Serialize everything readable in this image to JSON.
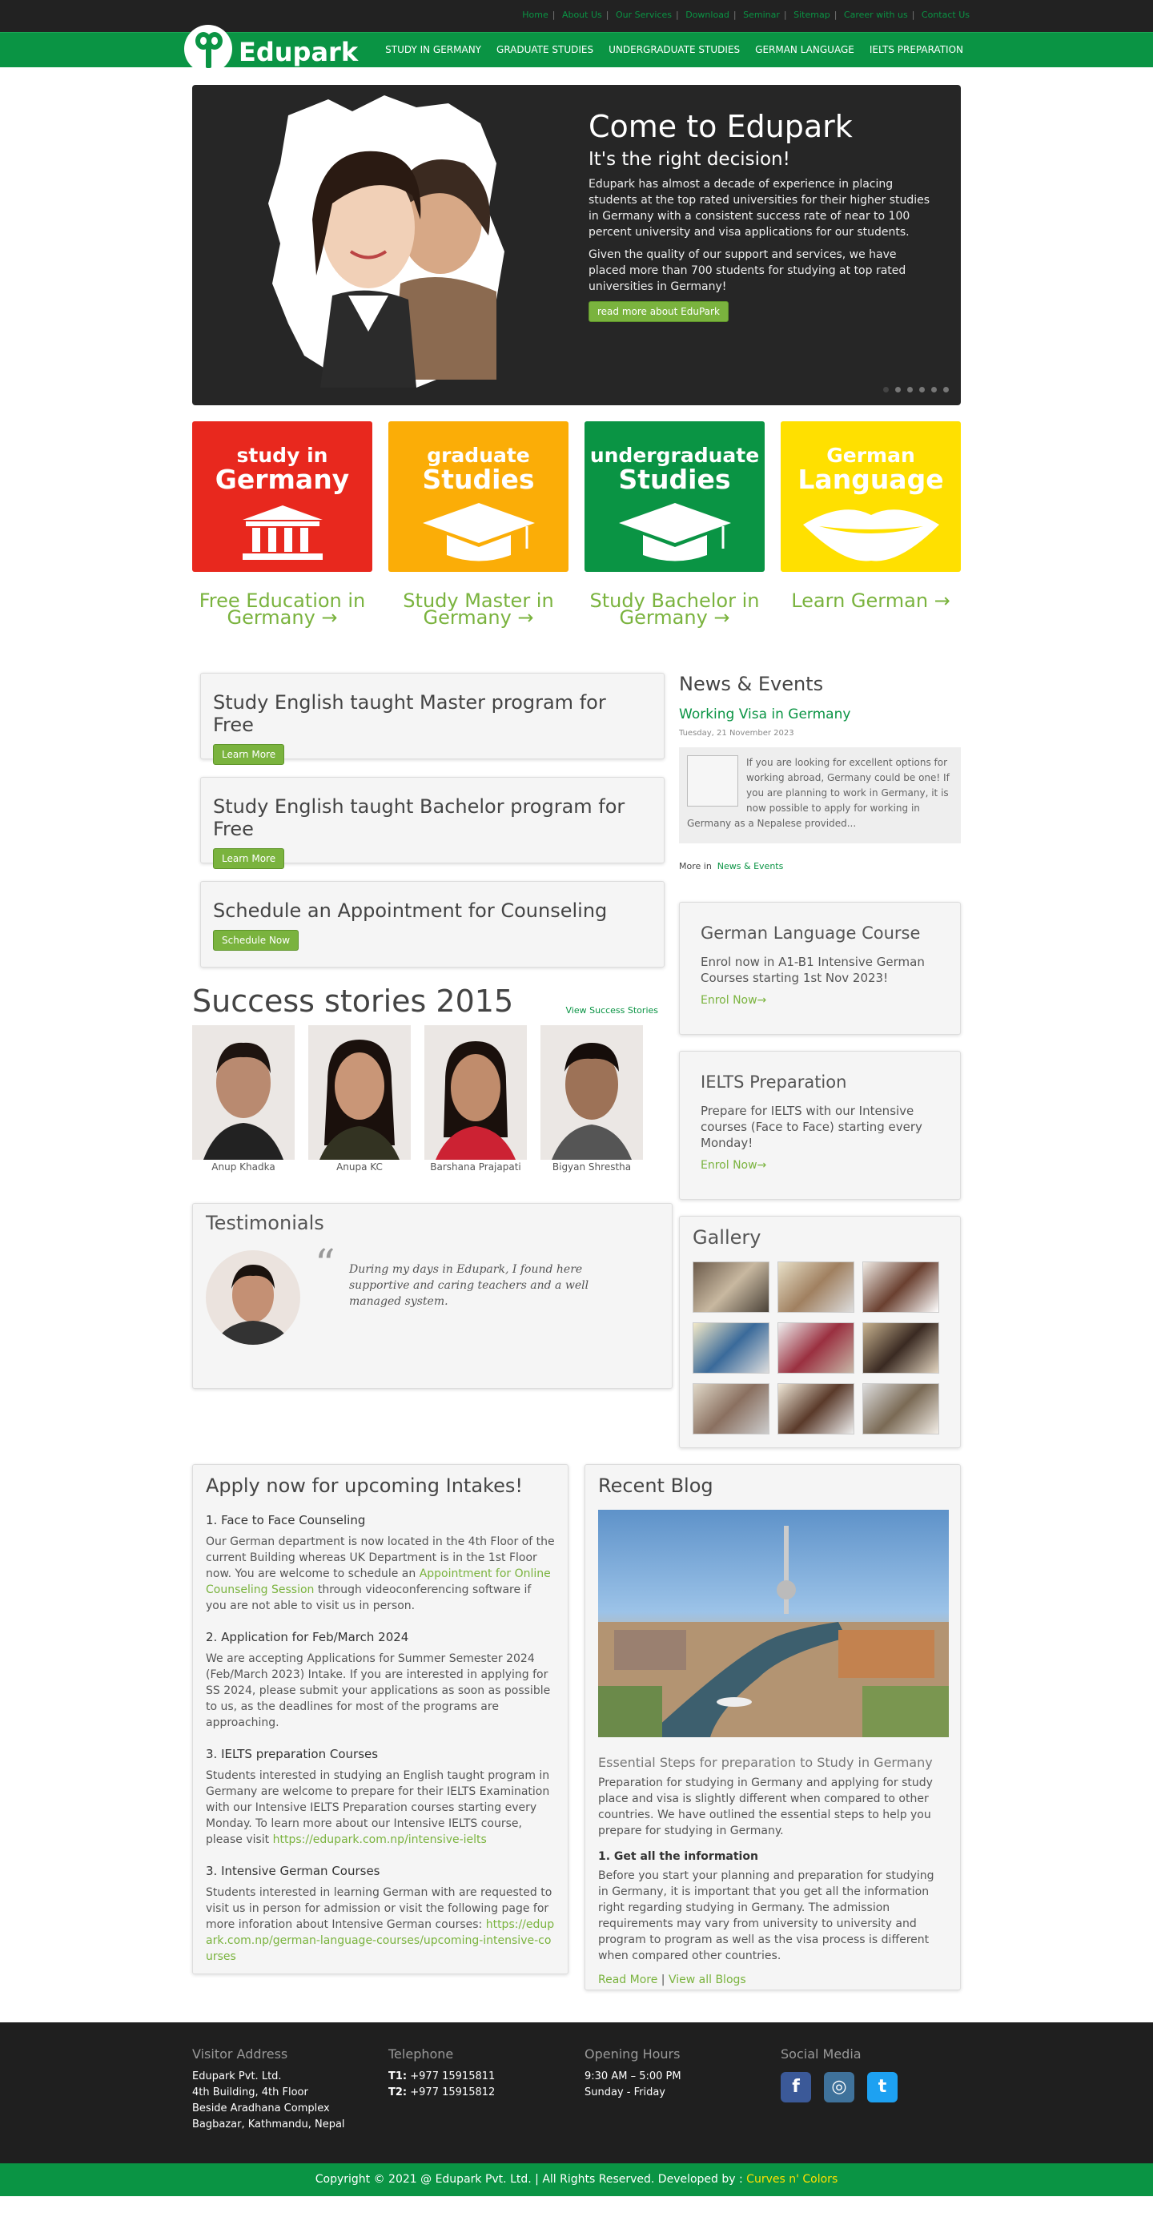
{
  "top_links": [
    "Home",
    "About Us",
    "Our Services",
    "Download",
    "Seminar",
    "Sitemap",
    "Career with us",
    "Contact Us"
  ],
  "brand": {
    "name": "Edupark",
    "color": "#0a9444"
  },
  "nav": [
    "STUDY IN GERMANY",
    "GRADUATE STUDIES",
    "UNDERGRADUATE STUDIES",
    "GERMAN LANGUAGE",
    "IELTS PREPARATION"
  ],
  "hero": {
    "title": "Come to Edupark",
    "subtitle": "It's the right decision!",
    "para1": "Edupark has almost a decade of experience in placing students at the top rated universities for their higher studies in Germany with a consistent success rate of near to 100 percent university and visa applications for our students.",
    "para2": "Given the quality of our support and services, we have placed more than 700 students for studying at top rated universities in Germany!",
    "button": "read more about EduPark"
  },
  "tiles": [
    {
      "line1": "study in",
      "line2": "Germany",
      "link": "Free Education in Germany →",
      "color": "#e8281e",
      "icon": "building-icon"
    },
    {
      "line1": "graduate",
      "line2": "Studies",
      "link": "Study Master in Germany →",
      "color": "#fbad07",
      "icon": "graduation-cap-icon"
    },
    {
      "line1": "undergraduate",
      "line2": "Studies",
      "link": "Study Bachelor in Germany →",
      "color": "#0a9444",
      "icon": "graduation-cap-icon"
    },
    {
      "line1": "German",
      "line2": "Language",
      "link": "Learn German →",
      "color": "#ffe000",
      "icon": "lips-icon"
    }
  ],
  "cta": [
    {
      "title": "Study English taught Master program for Free",
      "button": "Learn More"
    },
    {
      "title": "Study English taught Bachelor program for Free",
      "button": "Learn More"
    },
    {
      "title": "Schedule an Appointment for Counseling",
      "button": "Schedule Now"
    }
  ],
  "news": {
    "heading": "News & Events",
    "item_title": "Working Visa in Germany",
    "date": "Tuesday, 21 November 2023",
    "excerpt": "If you are looking for excellent options for working abroad, Germany could be one! If you are planning to work in Germany, it is now possible to apply for working in Germany as a Nepalese provided...",
    "more_label": "More in",
    "more_link": "News & Events"
  },
  "german_course": {
    "title": "German Language Course",
    "text": "Enrol now in A1-B1 Intensive German Courses starting 1st Nov 2023!",
    "link": "Enrol Now→"
  },
  "ielts": {
    "title": "IELTS Preparation",
    "text": "Prepare for IELTS with our Intensive courses (Face to Face) starting every Monday!",
    "link": "Enrol Now→"
  },
  "success": {
    "heading": "Success stories 2015",
    "link": "View Success Stories",
    "people": [
      "Anup Khadka",
      "Anupa KC",
      "Barshana Prajapati",
      "Bigyan Shrestha"
    ]
  },
  "testimonials": {
    "heading": "Testimonials",
    "quote": "During my days in Edupark, I found here supportive and caring teachers and a well managed system."
  },
  "gallery": {
    "heading": "Gallery"
  },
  "apply": {
    "heading": "Apply now for upcoming Intakes!",
    "s1_title": "1. Face to Face Counseling",
    "s1_text_a": "Our German department is now located in the 4th Floor of the current Building whereas UK Department is in the 1st Floor now. You are welcome to schedule an ",
    "s1_link": "Appointment for Online Counseling Session",
    "s1_text_b": " through videoconferencing software if you are not able to visit us in person.",
    "s2_title": "2. Application for Feb/March 2024",
    "s2_text": "We are accepting Applications for  Summer Semester 2024 (Feb/March 2023) Intake. If you are interested in applying for SS 2024, please submit your applications as soon as possible to us, as the deadlines for most of the programs are approaching.",
    "s3_title": "3. IELTS preparation Courses",
    "s3_text": "Students interested in studying an English taught program in Germany are welcome to prepare for their IELTS Examination with our Intensive IELTS Preparation courses starting every Monday. To learn more about our Intensive IELTS course, please visit ",
    "s3_link": "https://edupark.com.np/intensive-ielts",
    "s4_title": "3. Intensive German Courses",
    "s4_text": "Students interested in learning German with are requested to visit us in person for admission or visit the following page for more inforation about Intensive German courses: ",
    "s4_link": "https://edupark.com.np/german-language-courses/upcoming-intensive-courses"
  },
  "blog": {
    "heading": "Recent Blog",
    "title": "Essential Steps for preparation to Study in Germany",
    "intro": "Preparation for studying in Germany and applying for study place and visa is slightly different when compared to other countries. We have outlined the essential steps to help you prepare for studying in Germany.",
    "sub": "1. Get all the information",
    "text": "Before you start your planning and preparation for studying in Germany, it is important that you get all the information right regarding studying in Germany. The admission requirements may vary from university to university and program to program as well as the visa process is different when compared other countries.",
    "read_more": "Read More",
    "sep": "|",
    "view_all": "View all Blogs"
  },
  "footer": {
    "visitor_heading": "Visitor Address",
    "company": "Edupark Pvt. Ltd.",
    "addr1": "4th Building,  4th Floor",
    "addr2": "Beside Aradhana Complex",
    "addr3": "Bagbazar, Kathmandu, Nepal",
    "phone_heading": "Telephone",
    "t1_label": "T1:",
    "t1": "+977 15915811",
    "t2_label": "T2:",
    "t2": "+977 15915812",
    "hours_heading": "Opening Hours",
    "hours": "9:30 AM – 5:00 PM",
    "days": "Sunday - Friday",
    "social_heading": "Social Media",
    "social": [
      {
        "icon": "facebook-icon",
        "glyph": "f",
        "color": "#3b5998"
      },
      {
        "icon": "instagram-icon",
        "glyph": "◎",
        "color": "#3f729b"
      },
      {
        "icon": "twitter-icon",
        "glyph": "t",
        "color": "#1da1f2"
      }
    ]
  },
  "copyright": {
    "text": "Copyright © 2021 @ Edupark Pvt. Ltd. | All Rights Reserved. Developed by : ",
    "dev": "Curves n' Colors"
  }
}
